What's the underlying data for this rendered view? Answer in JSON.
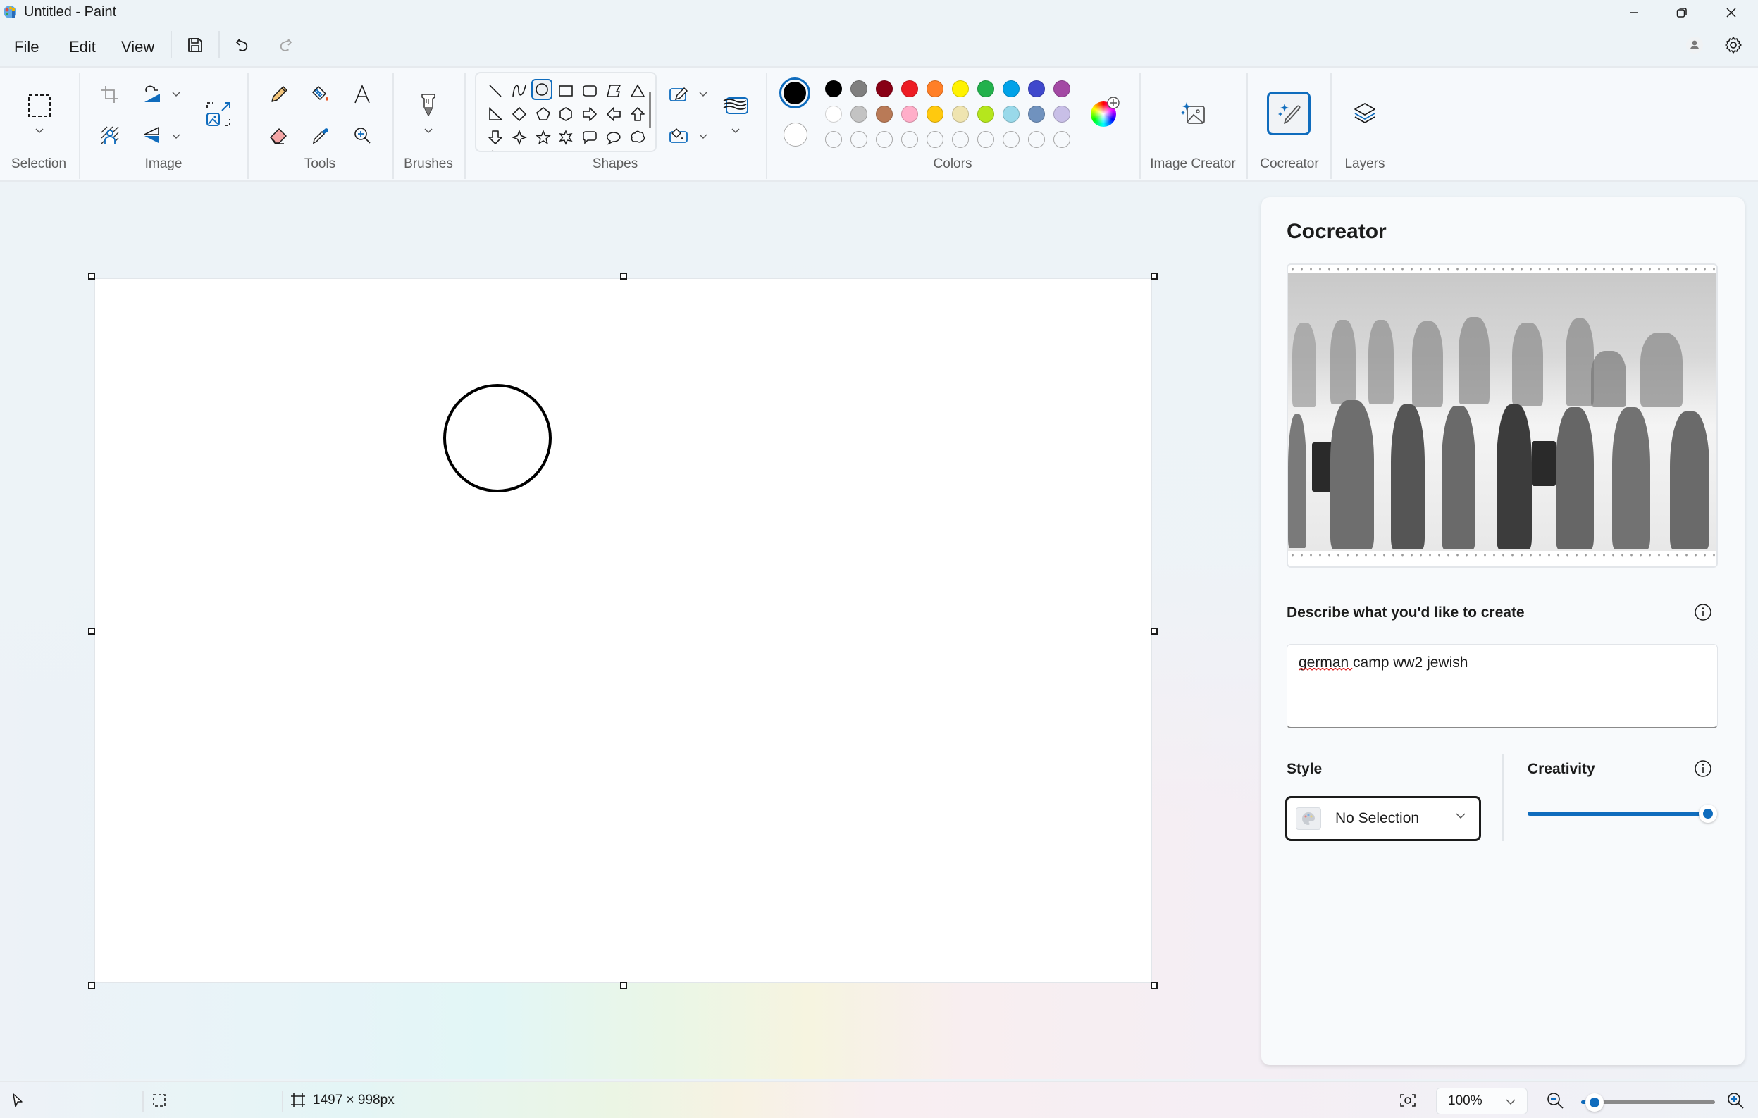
{
  "window": {
    "title": "Untitled - Paint",
    "controls": [
      "minimize",
      "restore",
      "close"
    ]
  },
  "menu": {
    "items": [
      "File",
      "Edit",
      "View"
    ],
    "quick_actions": [
      "save-icon",
      "undo-icon",
      "redo-icon"
    ]
  },
  "ribbon": {
    "groups": {
      "selection": "Selection",
      "image": "Image",
      "tools": "Tools",
      "brushes": "Brushes",
      "shapes": "Shapes",
      "colors": "Colors"
    },
    "commands": {
      "image_creator": "Image Creator",
      "cocreator": "Cocreator",
      "layers": "Layers"
    },
    "shapes": [
      "line",
      "curve",
      "oval",
      "rectangle",
      "rounded-rectangle",
      "polygon",
      "triangle",
      "right-triangle",
      "diamond",
      "pentagon",
      "hexagon",
      "right-arrow",
      "left-arrow",
      "up-arrow",
      "down-arrow",
      "four-point-star",
      "five-point-star",
      "six-point-star",
      "rounded-rectangle-callout",
      "oval-callout",
      "cloud-callout"
    ],
    "selected_shape": "oval",
    "colors": {
      "primary": "#000000",
      "secondary": "#ffffff",
      "palette_row1": [
        "#000000",
        "#7f7f7f",
        "#880015",
        "#ed1c24",
        "#ff7f27",
        "#fff200",
        "#22b14c",
        "#00a2e8",
        "#3f48cc",
        "#a349a4"
      ],
      "palette_row2": [
        "#ffffff",
        "#c3c3c3",
        "#b97a57",
        "#ffaec9",
        "#ffc90e",
        "#efe4b0",
        "#b5e61d",
        "#99d9ea",
        "#7092be",
        "#c8bfe7"
      ],
      "custom_slots": 10
    }
  },
  "canvas": {
    "size_label": "1497 × 998px",
    "shapes": [
      {
        "type": "circle",
        "stroke": "#000000"
      }
    ]
  },
  "cocreator": {
    "title": "Cocreator",
    "prompt_label": "Describe what you'd like to create",
    "prompt_value": "german camp ww2 jewish",
    "style_label": "Style",
    "style_value": "No Selection",
    "creativity_label": "Creativity",
    "creativity_value": 1.0
  },
  "status": {
    "canvas_size": "1497 × 998px",
    "zoom": "100%",
    "zoom_fraction": 0.1
  }
}
